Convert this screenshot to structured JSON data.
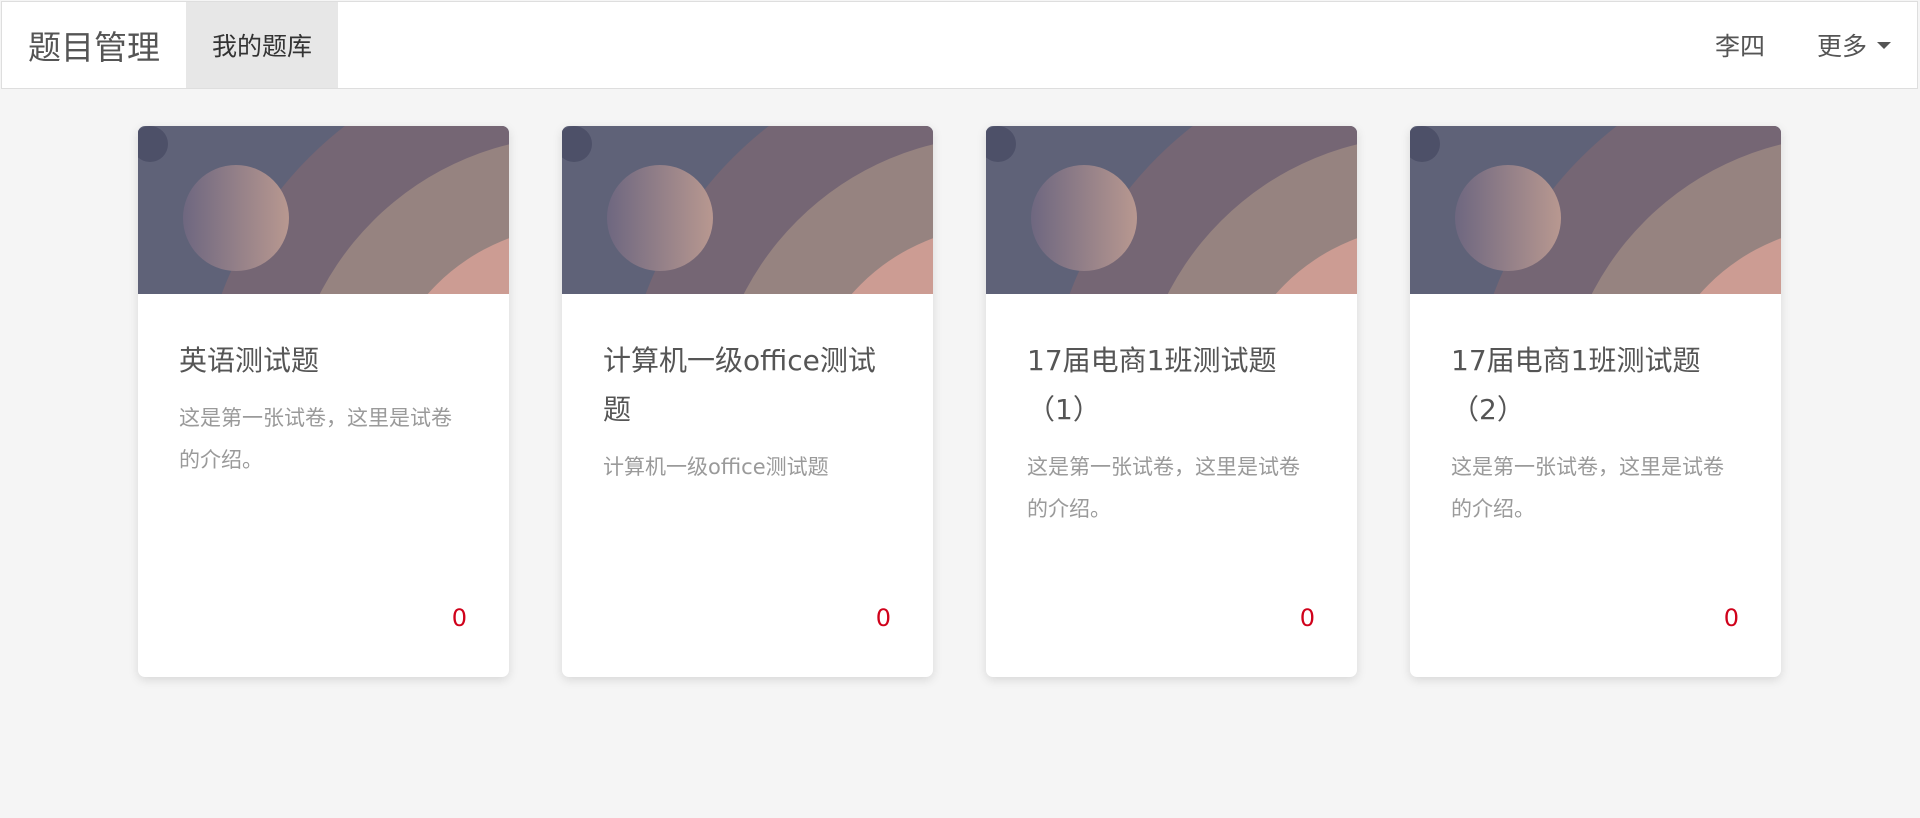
{
  "navbar": {
    "brand": "题目管理",
    "tab_active": "我的题库",
    "user_name": "李四",
    "more_label": "更多"
  },
  "colors": {
    "accent_red": "#d0021b",
    "banner_dark": "#5f6278",
    "banner_pink": "#cc9c93"
  },
  "cards": [
    {
      "title": "英语测试题",
      "description": "这是第一张试卷，这里是试卷的介绍。",
      "count": "0"
    },
    {
      "title": "计算机一级office测试题",
      "description": "计算机一级office测试题",
      "count": "0"
    },
    {
      "title": "17届电商1班测试题（1）",
      "description": "这是第一张试卷，这里是试卷的介绍。",
      "count": "0"
    },
    {
      "title": "17届电商1班测试题（2）",
      "description": "这是第一张试卷，这里是试卷的介绍。",
      "count": "0"
    }
  ]
}
